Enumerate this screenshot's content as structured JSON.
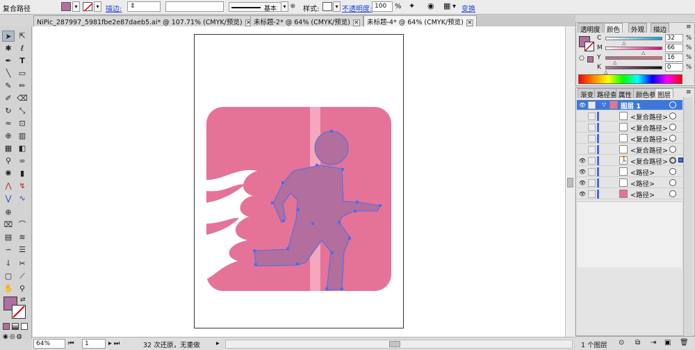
{
  "control_bar": {
    "object_type": "复合路径",
    "stroke_label": "描边:",
    "stroke_style": "基本",
    "style_label": "样式:",
    "opacity_label": "不透明度:",
    "opacity_value": "100",
    "opacity_unit": "%",
    "transform_link": "变换"
  },
  "tabs": [
    {
      "label": "NiPic_287997_5981fbe2e87daeb5.ai* @ 107.71% (CMYK/预览)"
    },
    {
      "label": "未标题-2* @ 64% (CMYK/预览)"
    },
    {
      "label": "未标题-4* @ 64% (CMYK/预览)"
    }
  ],
  "status_bar": {
    "zoom": "64%",
    "page": "1",
    "info": "32 次还原，无重做"
  },
  "color_panel": {
    "tabs": [
      "透明度",
      "颜色",
      "外观",
      "描边"
    ],
    "sliders": [
      {
        "label": "C",
        "value": "32",
        "unit": "%",
        "level": 0.32
      },
      {
        "label": "M",
        "value": "66",
        "unit": "%",
        "level": 0.66
      },
      {
        "label": "Y",
        "value": "16",
        "unit": "%",
        "level": 0.16
      },
      {
        "label": "K",
        "value": "0",
        "unit": "%",
        "level": 0.0
      }
    ]
  },
  "layers_panel": {
    "tabs": [
      "渐变",
      "路径查",
      "属性",
      "颜色参",
      "图层"
    ],
    "rows": [
      {
        "name": "图层 1",
        "type": "layer"
      },
      {
        "name": "<复合路径>",
        "type": "item"
      },
      {
        "name": "<复合路径>",
        "type": "item"
      },
      {
        "name": "<复合路径>",
        "type": "item"
      },
      {
        "name": "<复合路径>",
        "type": "item"
      },
      {
        "name": "<复合路径>",
        "type": "item"
      },
      {
        "name": "<路径>",
        "type": "item"
      },
      {
        "name": "<路径>",
        "type": "item"
      },
      {
        "name": "<路径>",
        "type": "item"
      }
    ],
    "footer_count": "1 个图层"
  },
  "colors": {
    "sign_pink": "#e57397",
    "figure_purple": "#b26e9c",
    "door_stripe": "#f4a7bd",
    "anchor_blue": "#4a6cf0",
    "fill_swatch": "#b26e9c"
  }
}
